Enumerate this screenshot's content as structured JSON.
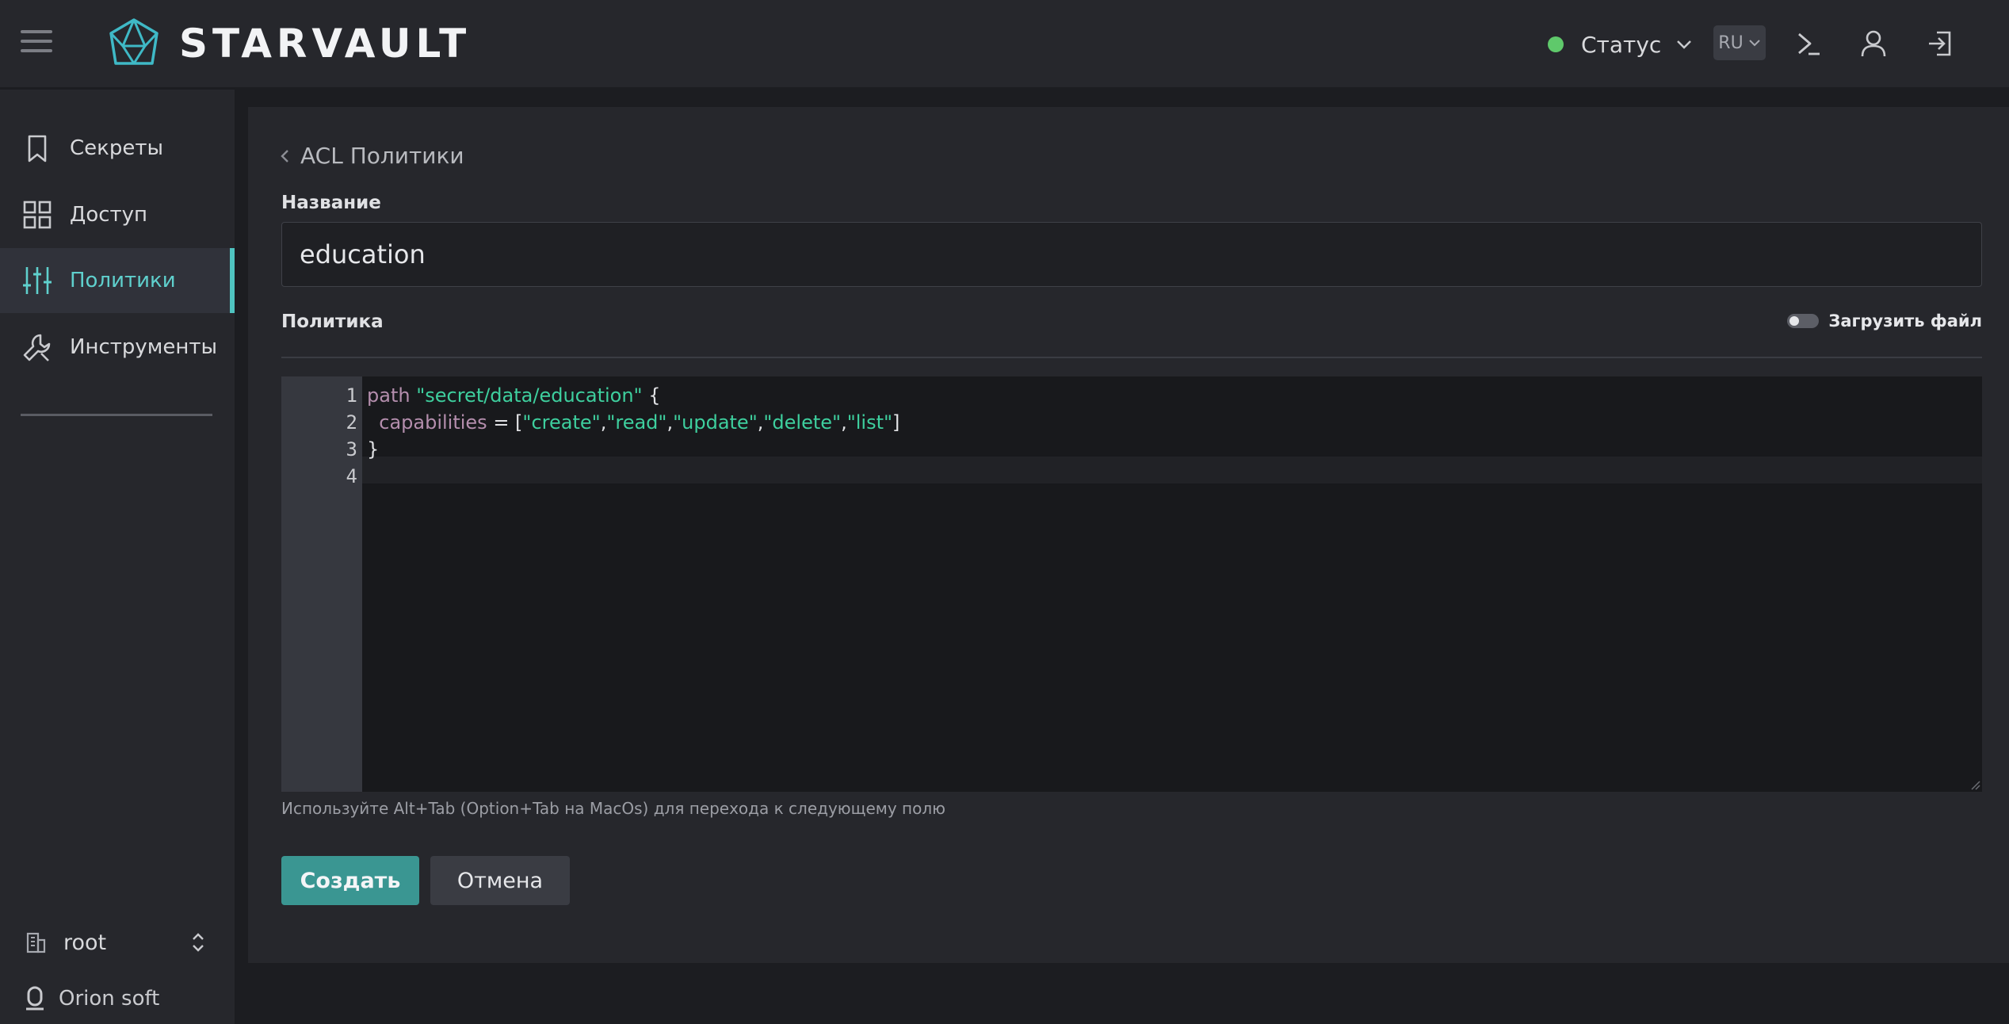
{
  "app": {
    "brand": "STARVAULT",
    "menu_icon": "hamburger-menu-icon",
    "logo_icon": "crystal-logo-icon"
  },
  "topbar": {
    "status_label": "Статус",
    "status_color": "#5fc96b",
    "language": "RU",
    "icons": [
      "terminal-icon",
      "user-icon",
      "logout-icon"
    ]
  },
  "sidebar": {
    "items": [
      {
        "label": "Секреты",
        "icon": "bookmark-icon",
        "active": false
      },
      {
        "label": "Доступ",
        "icon": "grid-icon",
        "active": false
      },
      {
        "label": "Политики",
        "icon": "sliders-icon",
        "active": true
      },
      {
        "label": "Инструменты",
        "icon": "wrench-icon",
        "active": false
      }
    ],
    "namespace": "root",
    "organization": "Orion soft",
    "accent_color": "#4fc3c0"
  },
  "page": {
    "breadcrumb": "ACL Политики",
    "name_label": "Название",
    "name_value": "education",
    "policy_label": "Политика",
    "upload_toggle_label": "Загрузить файл",
    "upload_toggle_on": false
  },
  "editor": {
    "line_numbers": [
      "1",
      "2",
      "3",
      "4"
    ],
    "lines": [
      [
        {
          "t": "path",
          "c": "kw"
        },
        {
          "t": " ",
          "c": "pl"
        },
        {
          "t": "\"secret/data/education\"",
          "c": "str"
        },
        {
          "t": " {",
          "c": "pl"
        }
      ],
      [
        {
          "t": "  capabilities",
          "c": "kw"
        },
        {
          "t": " = [",
          "c": "pl"
        },
        {
          "t": "\"create\"",
          "c": "str"
        },
        {
          "t": ",",
          "c": "pl"
        },
        {
          "t": "\"read\"",
          "c": "str"
        },
        {
          "t": ",",
          "c": "pl"
        },
        {
          "t": "\"update\"",
          "c": "str"
        },
        {
          "t": ",",
          "c": "pl"
        },
        {
          "t": "\"delete\"",
          "c": "str"
        },
        {
          "t": ",",
          "c": "pl"
        },
        {
          "t": "\"list\"",
          "c": "str"
        },
        {
          "t": "]",
          "c": "pl"
        }
      ],
      [
        {
          "t": "}",
          "c": "pl"
        }
      ],
      []
    ],
    "hint": "Используйте Alt+Tab (Option+Tab на MacOs) для перехода к следующему полю"
  },
  "actions": {
    "create_label": "Создать",
    "cancel_label": "Отмена",
    "primary_color": "#3a9692"
  }
}
